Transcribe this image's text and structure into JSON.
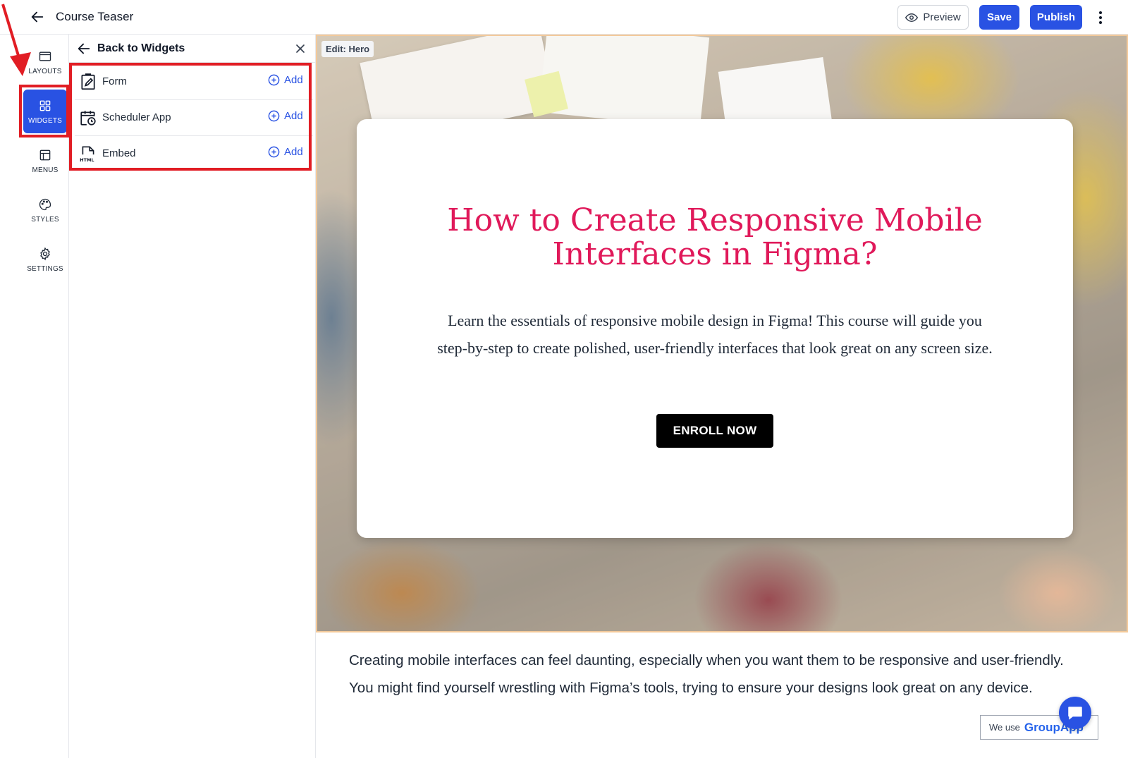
{
  "header": {
    "page_name": "Course Teaser",
    "preview_label": "Preview",
    "save_label": "Save",
    "publish_label": "Publish"
  },
  "rail": {
    "items": [
      {
        "label": "LAYOUTS",
        "icon": "layout-icon"
      },
      {
        "label": "WIDGETS",
        "icon": "grid-icon",
        "active": true
      },
      {
        "label": "MENUS",
        "icon": "menu-layout-icon"
      },
      {
        "label": "STYLES",
        "icon": "palette-icon"
      },
      {
        "label": "SETTINGS",
        "icon": "gear-icon"
      }
    ]
  },
  "panel": {
    "title": "Back to Widgets",
    "widgets": [
      {
        "label": "Form",
        "icon": "form-icon",
        "add_label": "Add"
      },
      {
        "label": "Scheduler App",
        "icon": "calendar-clock-icon",
        "add_label": "Add"
      },
      {
        "label": "Embed",
        "icon": "html-file-icon",
        "add_label": "Add"
      }
    ]
  },
  "canvas": {
    "edit_tag": "Edit: Hero",
    "hero": {
      "title": "How to Create Responsive Mobile Interfaces in Figma?",
      "description": "Learn the essentials of responsive mobile design in Figma! This course will guide you step-by-step to create polished, user-friendly interfaces that look great on any screen size.",
      "cta_label": "ENROLL NOW"
    },
    "body_text": "Creating mobile interfaces can feel daunting, especially when you want them to be responsive and user-friendly. You might find yourself wrestling with Figma’s tools, trying to ensure your designs look great on any device."
  },
  "cookie": {
    "prefix": "We use",
    "brand": "GroupApp"
  },
  "colors": {
    "primary": "#2952e3",
    "hero_title": "#e0195a",
    "annotation": "#e11d24",
    "hero_border": "#f3c99a"
  }
}
